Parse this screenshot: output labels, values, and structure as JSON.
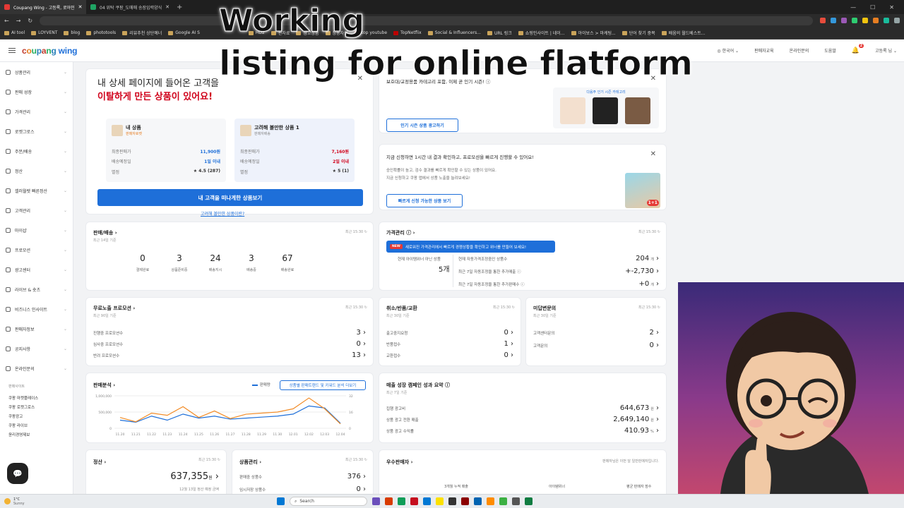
{
  "browser": {
    "tabs": [
      {
        "title": "Coupang Wing - 고등록, 로아인",
        "active": true
      },
      {
        "title": "04 위탁 쿠팡_도매매 송장입력양식",
        "active": false
      }
    ],
    "bookmarks": [
      "AI tool",
      "LOYVENT",
      "blog",
      "phototools",
      "리뷰추천 상단예너",
      "Google AI S",
      "HD2",
      "판자료",
      "참고상품",
      "창용자원",
      "top youtube",
      "TopNetflix",
      "Social & Influencers...",
      "URL 링크",
      "쇼핑인사이트 | 네이...",
      "아이보스 > 마케팅...",
      "단어 찾기 중복",
      "배움의 월드베스트..."
    ]
  },
  "header": {
    "logo_parts": [
      "c",
      "o",
      "u",
      "p",
      "a",
      "n",
      "g"
    ],
    "logo_text": "coupang",
    "logo_wing": "wing",
    "lang": "한국어",
    "links": [
      "판매자교육",
      "온라인문의",
      "도움말"
    ],
    "bell_count": "2",
    "user": "고등록 님"
  },
  "overlay": {
    "line1": "Working",
    "line2": "listing for online flatform"
  },
  "sidebar": {
    "items": [
      "상품관리",
      "판매 성장",
      "가격관리",
      "로켓그로스",
      "주문/배송",
      "정산",
      "셀러월렛 빠른정산",
      "고객관리",
      "마이샵",
      "프로모션",
      "광고센터",
      "라이브 & 숏츠",
      "비즈니스 인사이트",
      "판매자정보",
      "공지사항",
      "온라인문의"
    ],
    "links_title": "판매사이트",
    "links": [
      "쿠팡 마켓플레이스",
      "쿠팡 로켓그로스",
      "쿠팡광고",
      "쿠팡 라이브",
      "윤리경영제보"
    ],
    "bottom_link": "파트너 사이트"
  },
  "promo1": {
    "line1": "내 상세 페이지에 들어온 고객을",
    "line2": "이탈하게 만든 상품이 있어요!",
    "mine": {
      "name": "내 상품",
      "badge": "판매자로켓",
      "price_label": "최종판매가",
      "price": "11,900원",
      "ship_label": "배송예정일",
      "ship": "1일 이내",
      "rating_label": "별점",
      "rating": "★ 4.5 (287)"
    },
    "rival": {
      "name": "고려해 볼만한 상품 1",
      "badge": "판매자배송",
      "price_label": "최종판매가",
      "price": "7,160원",
      "ship_label": "배송예정일",
      "ship": "2일 이내",
      "rating_label": "별점",
      "rating": "★ 5 (1)"
    },
    "button": "내 고객을 떠나게한 상품보기",
    "link": "고려해 볼만한 상품이란?"
  },
  "promo2": {
    "text": "보호대/교정용품 카테고리 포함, 이제 곧 인기 시즌! ⓘ",
    "badge": "다음주 인기 시즌 카테고리",
    "button": "인기 시즌 상품 광고하기"
  },
  "promo3": {
    "title": "지금 신청하면 1시간 내 결과 확인하고, 프로모션을 빠르게 진행할 수 있어요!",
    "desc1": "승인확률이 높고, 검수 결과를 빠르게 확인할 수 있는 상품이 있어요.",
    "desc2": "지금 신청하고 쿠팡 앱에서 상품 노출을 늘려보세요!",
    "button": "빠르게 신청 가능한 상품 보기",
    "badge": "1+1"
  },
  "sales_ship": {
    "title": "판매/배송 ›",
    "sub": "최근 14일 기준",
    "time": "최근 15:30 ↻",
    "stats": [
      {
        "n": "0",
        "l": "결제완료"
      },
      {
        "n": "3",
        "l": "상품준비중"
      },
      {
        "n": "24",
        "l": "배송지시"
      },
      {
        "n": "3",
        "l": "배송중"
      },
      {
        "n": "67",
        "l": "배송완료"
      }
    ]
  },
  "price_mgmt": {
    "title": "가격관리 ⓘ ›",
    "time": "최근 15:30 ↻",
    "new_badge": "NEW",
    "new_text": "새로워진 가격관리에서 빠르게 경쟁상황을 확인하고 위너를 만들어 보세요!",
    "winner_label": "현재 아이템위너 아닌 상품",
    "winner_value": "5개",
    "rows": [
      {
        "l": "현재 자동가격조정중인 상품수",
        "v": "204",
        "u": "개"
      },
      {
        "l": "최근 7일 자동조정을 통한 추가매출 ⓘ",
        "v": "+-2,730",
        "u": ""
      },
      {
        "l": "최근 7일 자동조정을 통한 추가판매수 ⓘ",
        "v": "+0",
        "u": "개"
      }
    ]
  },
  "free_promo": {
    "title": "무료노출 프로모션 ›",
    "sub": "최근 90일 기준",
    "time": "최근 15:30 ↻",
    "rows": [
      {
        "l": "진행중 프로모션수",
        "v": "3"
      },
      {
        "l": "심사중 프로모션수",
        "v": "0"
      },
      {
        "l": "반려 프로모션수",
        "v": "13"
      }
    ]
  },
  "cancel": {
    "title": "취소/반품/교환",
    "sub": "최근 30일 기준",
    "time": "최근 15:30 ↻",
    "rows": [
      {
        "l": "출고중지요청",
        "v": "0"
      },
      {
        "l": "반품접수",
        "v": "1"
      },
      {
        "l": "교환접수",
        "v": "0"
      }
    ]
  },
  "inquiry": {
    "title": "미답변문의",
    "sub": "최근 30일 기준",
    "time": "최근 15:30 ↻",
    "rows": [
      {
        "l": "고객센터문의",
        "v": "2"
      },
      {
        "l": "고객문의",
        "v": "0"
      }
    ]
  },
  "analysis": {
    "title": "판매분석 ›",
    "legend": [
      {
        "name": "판매량",
        "color": "#1e6fd9"
      },
      {
        "name": "매출",
        "color": "#f28c28"
      }
    ],
    "button": "상품별 판매트렌드 및 키워드 분석 더보기"
  },
  "chart_data": {
    "type": "line",
    "x": [
      "11.20",
      "11.21",
      "11.22",
      "11.23",
      "11.24",
      "11.25",
      "11.26",
      "11.27",
      "11.28",
      "11.29",
      "11.30",
      "12.01",
      "12.02",
      "12.03",
      "12.04"
    ],
    "series": [
      {
        "name": "판매량",
        "values": [
          8,
          6,
          12,
          8,
          14,
          10,
          12,
          9,
          10,
          11,
          12,
          14,
          22,
          20,
          5
        ]
      },
      {
        "name": "매출",
        "values": [
          500000,
          300000,
          700000,
          600000,
          1000000,
          500000,
          800000,
          450000,
          650000,
          700000,
          750000,
          900000,
          1400000,
          900000,
          200000
        ]
      }
    ],
    "yticks_left": [
      "1,000,000",
      "500,000",
      "0"
    ],
    "yticks_right": [
      "32",
      "16",
      "0"
    ],
    "ylim_left": [
      0,
      1500000
    ],
    "ylim_right": [
      0,
      32
    ],
    "grid": true
  },
  "growth": {
    "title": "매출 성장 캠페인 성과 요약 ⓘ",
    "sub": "최근 7일 기준",
    "rows": [
      {
        "l": "집행 광고비",
        "v": "644,673",
        "u": "원"
      },
      {
        "l": "상품 광고 전환 매출",
        "v": "2,649,140",
        "u": "원"
      },
      {
        "l": "상품 광고 수익률",
        "v": "410.93",
        "u": "%"
      }
    ]
  },
  "settlement": {
    "title": "정산 ›",
    "time": "최근 15:30 ↻",
    "value": "637,355",
    "unit": "원",
    "sub": "12월 13일 정산 예정 금액"
  },
  "product_mgmt": {
    "title": "상품관리 ›",
    "time": "최근 15:30 ↻",
    "rows": [
      {
        "l": "판매중 상품수",
        "v": "376"
      },
      {
        "l": "임시저장 상품수",
        "v": "0"
      }
    ]
  },
  "top_seller": {
    "title": "우수판매자 ›",
    "note": "판매자님은 이번 달 일반판매자입니다.",
    "cols": [
      "3개월 누적 매출",
      "아이템위너",
      "평균 판매자 점수"
    ]
  },
  "taskbar": {
    "temp": "1°C",
    "weather": "Sunny",
    "search": "Search",
    "notif": "4"
  }
}
